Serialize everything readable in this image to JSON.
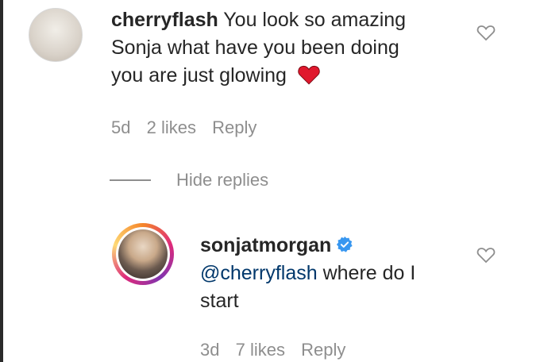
{
  "comment": {
    "username": "cherryflash",
    "text_line1": "You look so amazing",
    "text_line2": "Sonja what have you been doing",
    "text_line3": "you are just glowing",
    "emoji": "red-heart-icon",
    "age": "5d",
    "likes": "2 likes",
    "reply_label": "Reply"
  },
  "replies_toggle": {
    "label": "Hide replies"
  },
  "reply": {
    "username": "sonjatmorgan",
    "verified": "verified-badge-icon",
    "mention": "@cherryflash",
    "text_rest": " where do I",
    "text_line2": "start",
    "age": "3d",
    "likes": "7 likes",
    "reply_label": "Reply"
  },
  "colors": {
    "text": "#262626",
    "meta": "#8e8e8e",
    "mention": "#00376b",
    "verified": "#3897f0",
    "heart": "#e0182d"
  }
}
